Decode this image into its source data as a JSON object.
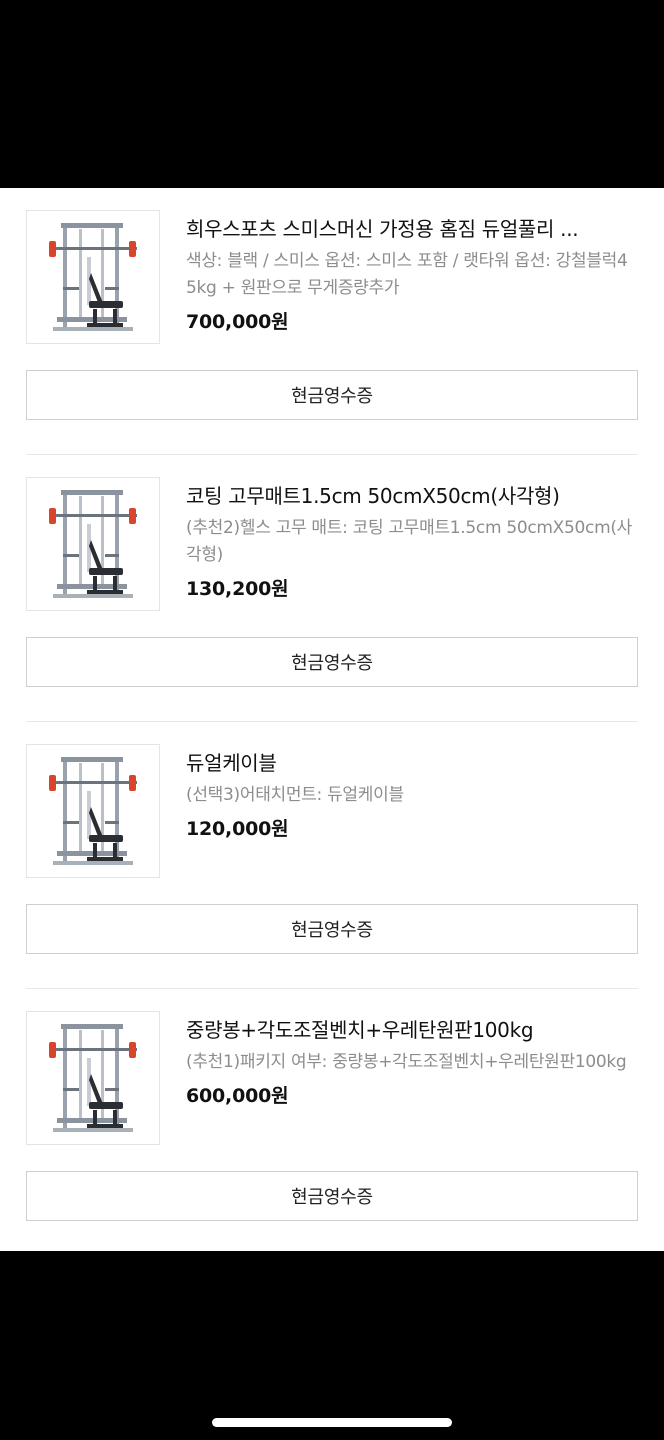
{
  "orders": [
    {
      "title": "희우스포츠 스미스머신 가정용 홈짐 듀얼풀리 ...",
      "option": "색상: 블랙 / 스미스 옵션: 스미스 포함 / 랫타워 옵션: 강철블럭45kg + 원판으로 무게증량추가",
      "price": "700,000원",
      "receipt_label": "현금영수증"
    },
    {
      "title": "코팅 고무매트1.5cm 50cmX50cm(사각형)",
      "option": "(추천2)헬스 고무 매트: 코팅 고무매트1.5cm 50cmX50cm(사각형)",
      "price": "130,200원",
      "receipt_label": "현금영수증"
    },
    {
      "title": "듀얼케이블",
      "option": "(선택3)어태치먼트: 듀얼케이블",
      "price": "120,000원",
      "receipt_label": "현금영수증"
    },
    {
      "title": "중량봉+각도조절벤치+우레탄원판100kg",
      "option": "(추천1)패키지 여부: 중량봉+각도조절벤치+우레탄원판100kg",
      "price": "600,000원",
      "receipt_label": "현금영수증"
    }
  ],
  "colors": {
    "background": "#ffffff",
    "frame": "#000000",
    "option_text": "#8d8d8d",
    "plate_red": "#d9452b"
  },
  "icons": {
    "thumbnail": "smith-machine-product-image"
  }
}
